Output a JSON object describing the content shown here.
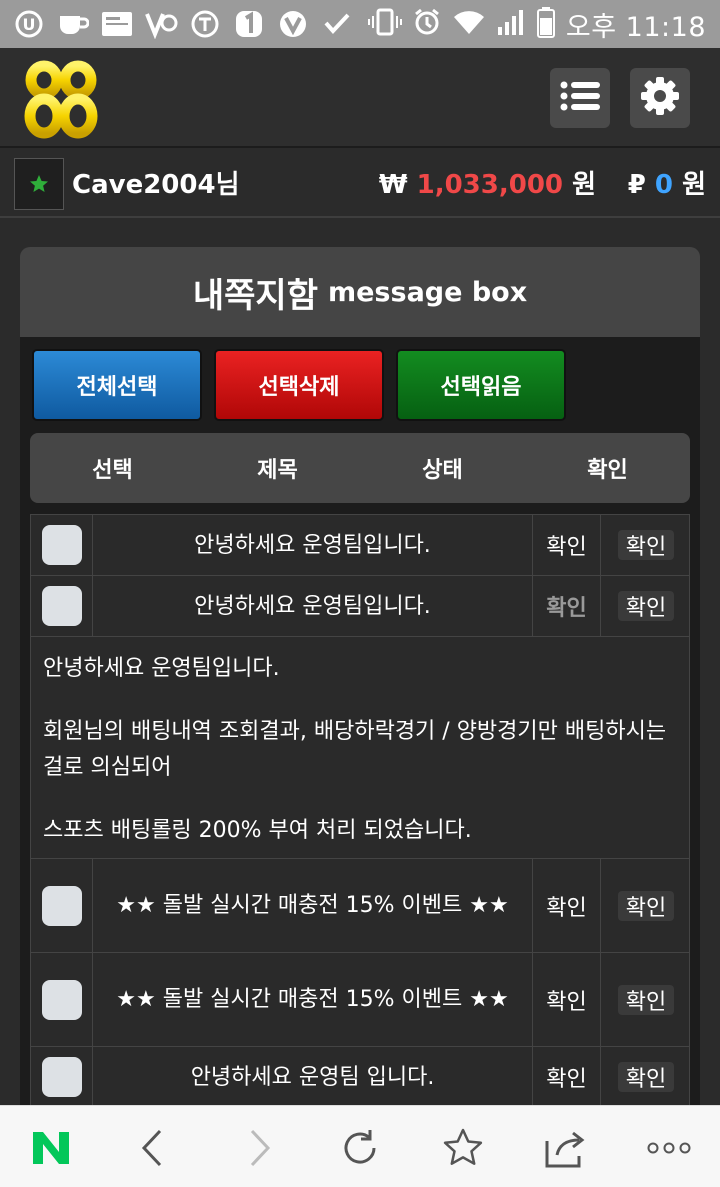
{
  "status_bar": {
    "time": "오후 11:18",
    "left_icons": [
      "u-plus-icon",
      "coffee-icon",
      "tmoney-icon",
      "network-speed-icon",
      "t-icon",
      "one-icon",
      "v-icon",
      "check-icon"
    ],
    "right_icons": [
      "vibrate-icon",
      "alarm-icon",
      "wifi-icon",
      "signal-icon",
      "battery-icon"
    ]
  },
  "header": {
    "logo": "88-logo",
    "menu_icon": "list-icon",
    "settings_icon": "gear-icon"
  },
  "user": {
    "name": "Cave2004님",
    "money_symbol": "₩",
    "money_value": "1,033,000",
    "money_unit": "원",
    "point_symbol": "₽",
    "point_value": "0",
    "point_unit": "원"
  },
  "panel": {
    "title_ko": "내쪽지함",
    "title_en": "message box",
    "buttons": {
      "select_all": "전체선택",
      "delete_selected": "선택삭제",
      "read_selected": "선택읽음"
    },
    "columns": {
      "select": "선택",
      "title": "제목",
      "status": "상태",
      "confirm": "확인"
    },
    "rows": [
      {
        "title": "안녕하세요 운영팀입니다.",
        "status": "확인",
        "confirm": "확인"
      },
      {
        "title": "안녕하세요 운영팀입니다.",
        "status": "확인",
        "confirm": "확인"
      },
      {
        "title": "★★ 돌발 실시간 매충전 15% 이벤트 ★★",
        "status": "확인",
        "confirm": "확인"
      },
      {
        "title": "★★ 돌발 실시간 매충전 15% 이벤트 ★★",
        "status": "확인",
        "confirm": "확인"
      },
      {
        "title": "안녕하세요 운영팀 입니다.",
        "status": "확인",
        "confirm": "확인"
      }
    ],
    "expanded_message": {
      "line1": "안녕하세요 운영팀입니다.",
      "line2": "회원님의 배팅내역 조회결과, 배당하락경기 / 양방경기만 배팅하시는걸로 의심되어",
      "line3": "스포츠 배팅롤링 200% 부여 처리 되었습니다."
    }
  },
  "bottom_nav": {
    "items": [
      "naver-icon",
      "back-icon",
      "forward-icon",
      "refresh-icon",
      "bookmark-star-icon",
      "share-icon",
      "more-icon"
    ]
  },
  "colors": {
    "money": "#f04848",
    "points": "#3fa4ff",
    "naver_green": "#03c75a"
  }
}
